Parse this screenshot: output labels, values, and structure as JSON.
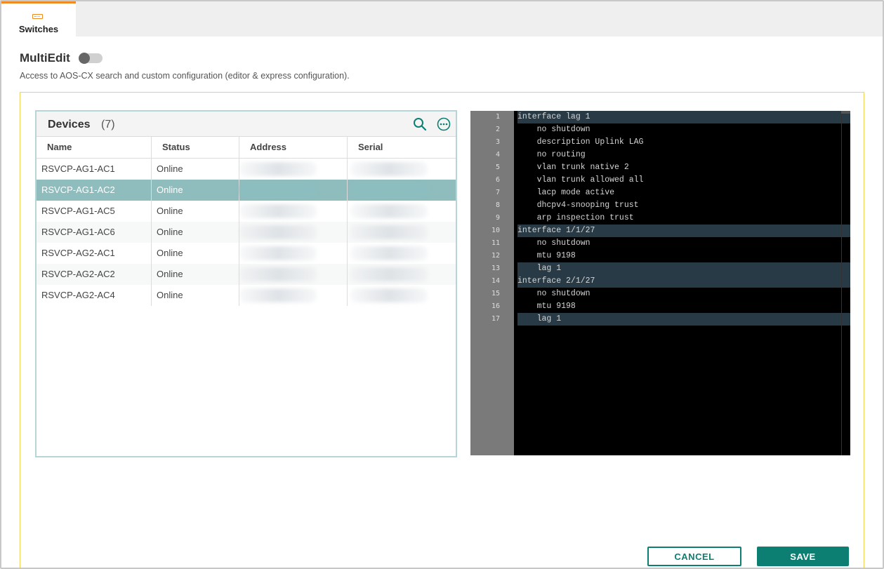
{
  "tabs": [
    {
      "label": "Switches",
      "icon": "switch-icon",
      "active": true
    }
  ],
  "multiedit": {
    "title": "MultiEdit",
    "toggle_on": false,
    "description": "Access to AOS-CX search and custom configuration (editor & express configuration)."
  },
  "devices": {
    "title": "Devices",
    "count": "(7)",
    "columns": [
      "Name",
      "Status",
      "Address",
      "Serial"
    ],
    "rows": [
      {
        "name": "RSVCP-AG1-AC1",
        "status": "Online",
        "selected": false
      },
      {
        "name": "RSVCP-AG1-AC2",
        "status": "Online",
        "selected": true
      },
      {
        "name": "RSVCP-AG1-AC5",
        "status": "Online",
        "selected": false
      },
      {
        "name": "RSVCP-AG1-AC6",
        "status": "Online",
        "selected": false
      },
      {
        "name": "RSVCP-AG2-AC1",
        "status": "Online",
        "selected": false
      },
      {
        "name": "RSVCP-AG2-AC2",
        "status": "Online",
        "selected": false
      },
      {
        "name": "RSVCP-AG2-AC4",
        "status": "Online",
        "selected": false
      }
    ]
  },
  "editor": {
    "lines": [
      {
        "n": "1",
        "text": "interface lag 1",
        "hl": true
      },
      {
        "n": "2",
        "text": "    no shutdown",
        "hl": false
      },
      {
        "n": "3",
        "text": "    description Uplink LAG",
        "hl": false
      },
      {
        "n": "4",
        "text": "    no routing",
        "hl": false
      },
      {
        "n": "5",
        "text": "    vlan trunk native 2",
        "hl": false
      },
      {
        "n": "6",
        "text": "    vlan trunk allowed all",
        "hl": false
      },
      {
        "n": "7",
        "text": "    lacp mode active",
        "hl": false
      },
      {
        "n": "8",
        "text": "    dhcpv4-snooping trust",
        "hl": false
      },
      {
        "n": "9",
        "text": "    arp inspection trust",
        "hl": false
      },
      {
        "n": "10",
        "text": "interface 1/1/27",
        "hl": true
      },
      {
        "n": "11",
        "text": "    no shutdown",
        "hl": false
      },
      {
        "n": "12",
        "text": "    mtu 9198",
        "hl": false
      },
      {
        "n": "13",
        "text": "    lag 1",
        "hl": true
      },
      {
        "n": "14",
        "text": "interface 2/1/27",
        "hl": true
      },
      {
        "n": "15",
        "text": "    no shutdown",
        "hl": false
      },
      {
        "n": "16",
        "text": "    mtu 9198",
        "hl": false
      },
      {
        "n": "17",
        "text": "    lag 1",
        "hl": true
      }
    ]
  },
  "buttons": {
    "cancel": "CANCEL",
    "save": "SAVE"
  },
  "colors": {
    "accent": "#0d7f72",
    "tab_accent": "#f28a24",
    "selected_row": "#8fbdbe"
  }
}
